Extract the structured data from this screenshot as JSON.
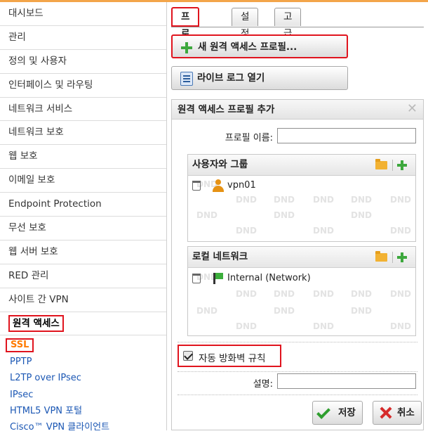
{
  "sidebar": {
    "items": [
      {
        "label": "대시보드"
      },
      {
        "label": "관리"
      },
      {
        "label": "정의 및 사용자"
      },
      {
        "label": "인터페이스 및 라우팅"
      },
      {
        "label": "네트워크 서비스"
      },
      {
        "label": "네트워크 보호"
      },
      {
        "label": "웹 보호"
      },
      {
        "label": "이메일 보호"
      },
      {
        "label": "Endpoint Protection"
      },
      {
        "label": "무선 보호"
      },
      {
        "label": "웹 서버 보호"
      },
      {
        "label": "RED 관리"
      },
      {
        "label": "사이트 간 VPN"
      },
      {
        "label": "원격 액세스"
      }
    ],
    "subitems": [
      {
        "label": "SSL"
      },
      {
        "label": "PPTP"
      },
      {
        "label": "L2TP over IPsec"
      },
      {
        "label": "IPsec"
      },
      {
        "label": "HTML5 VPN 포털"
      },
      {
        "label": "Cisco™ VPN 클라이언트"
      }
    ]
  },
  "tabs": [
    {
      "label": "프로필"
    },
    {
      "label": "설정"
    },
    {
      "label": "고급"
    }
  ],
  "toolbar": {
    "new_profile_label": "새 원격 액세스 프로필...",
    "live_log_label": "라이브 로그 열기"
  },
  "dialog": {
    "title": "원격 액세스 프로필 추가",
    "profile_name_label": "프로필 이름:",
    "profile_name_value": "",
    "users_groups": {
      "title": "사용자와 그룹",
      "entries": [
        {
          "name": "vpn01"
        }
      ],
      "watermark": "DND"
    },
    "local_networks": {
      "title": "로컬 네트워크",
      "entries": [
        {
          "name": "Internal (Network)"
        }
      ],
      "watermark": "DND"
    },
    "auto_firewall_label": "자동 방화벽 규칙",
    "auto_firewall_checked": true,
    "description_label": "설명:",
    "description_value": "",
    "save_label": "저장",
    "cancel_label": "취소"
  },
  "colors": {
    "accent_orange": "#f3a54a",
    "highlight_red": "#e0141e",
    "link_blue": "#1b57b4",
    "ssl_orange": "#ff7b00",
    "add_green": "#3da83d"
  }
}
